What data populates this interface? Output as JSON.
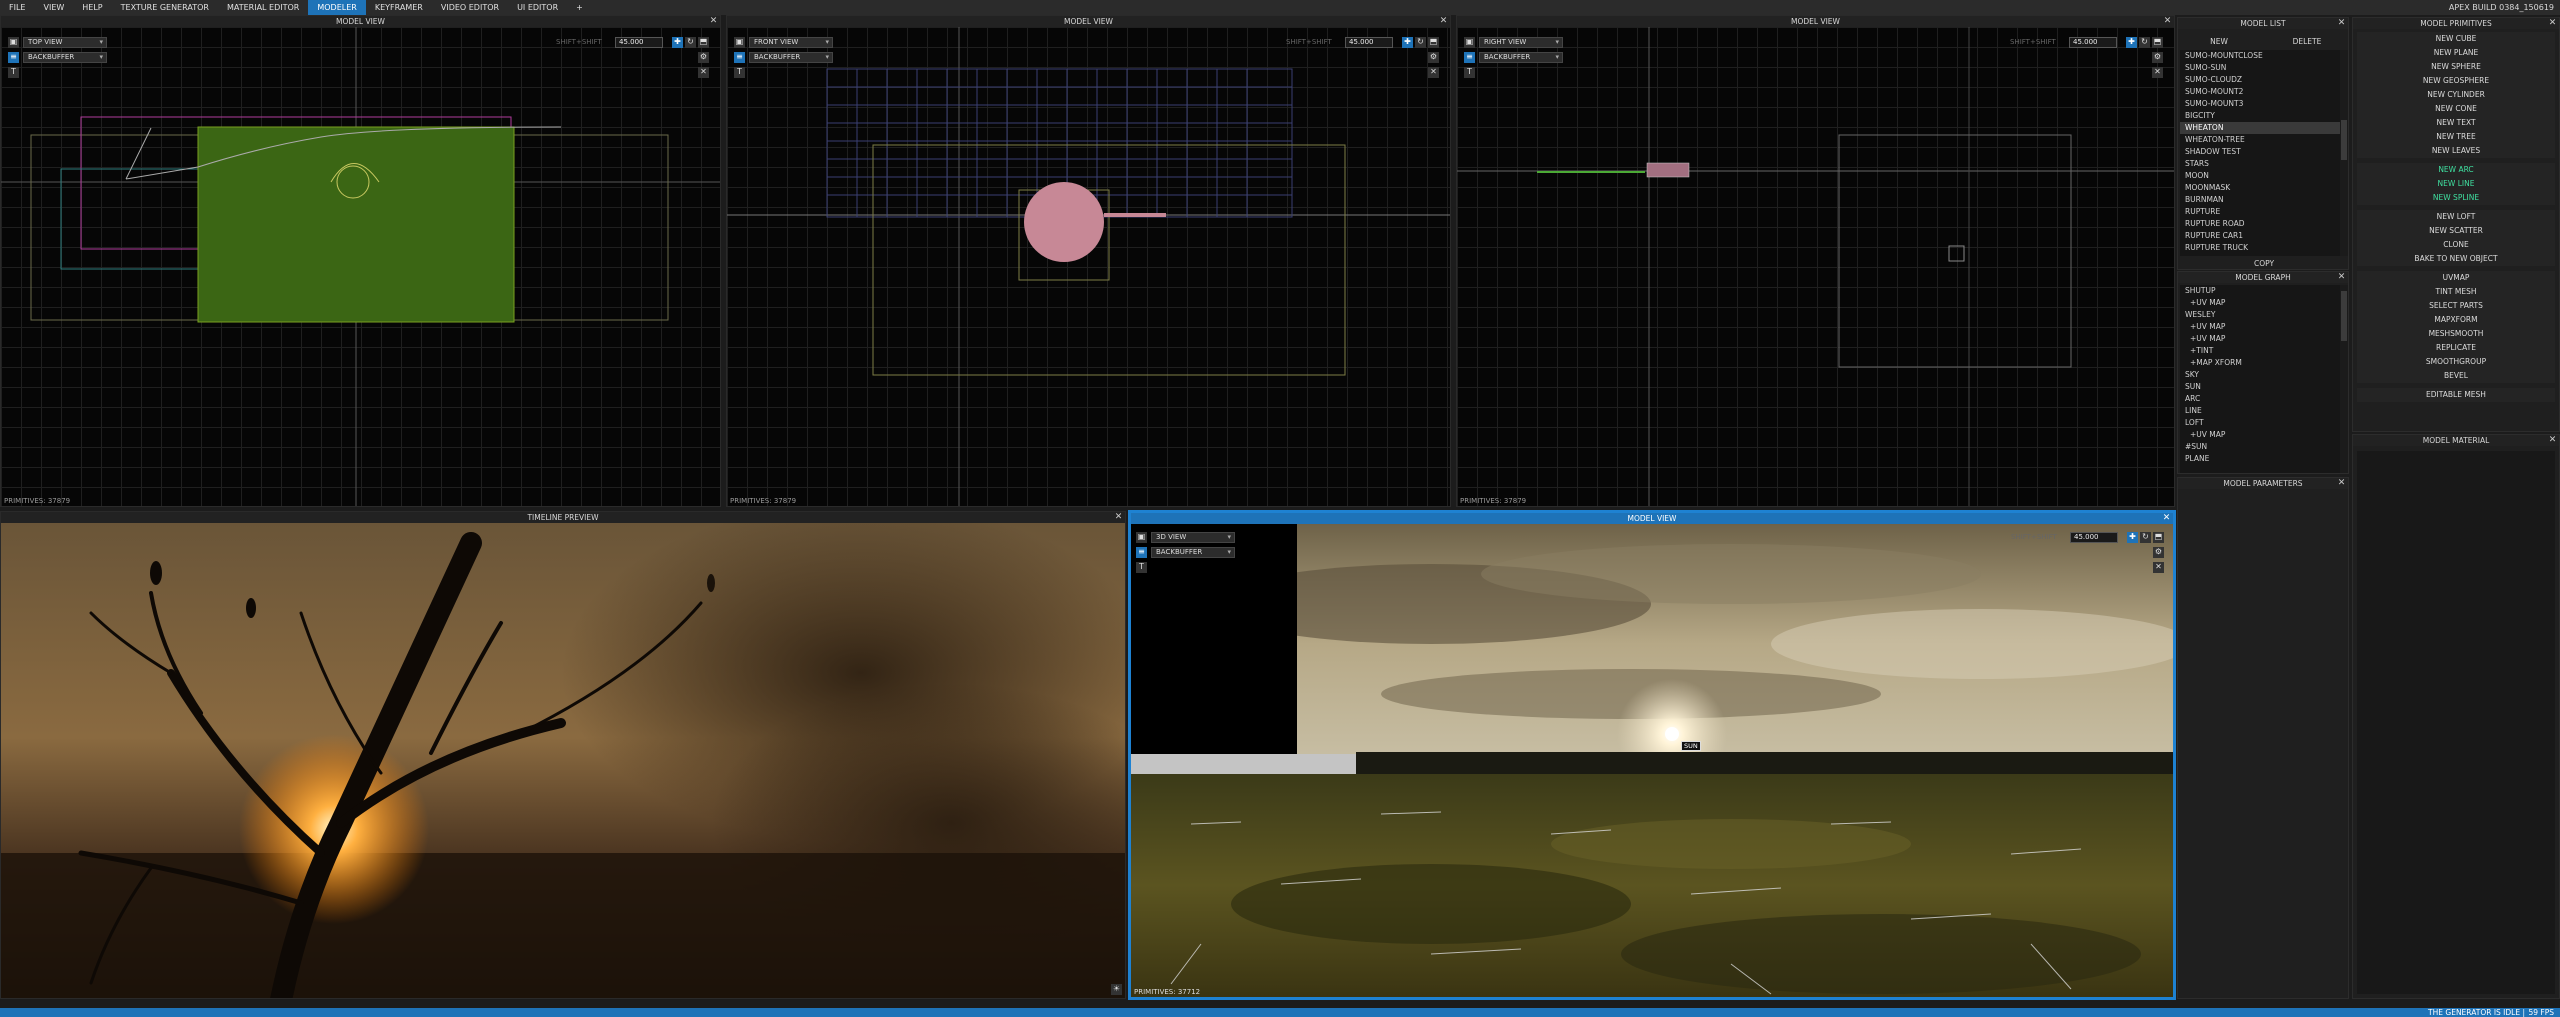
{
  "menu": {
    "items": [
      "FILE",
      "VIEW",
      "HELP",
      "TEXTURE GENERATOR",
      "MATERIAL EDITOR",
      "MODELER",
      "KEYFRAMER",
      "VIDEO EDITOR",
      "UI EDITOR",
      "+"
    ],
    "active_index": 5,
    "build": "APEX BUILD 0384_150619"
  },
  "viewports": {
    "top": {
      "title": "MODEL VIEW",
      "view": "TOP VIEW",
      "buffer": "BACKBUFFER",
      "shift": "SHIFT+SHIFT",
      "fov": "45.000",
      "primitives": "PRIMITIVES: 37879"
    },
    "front": {
      "title": "MODEL VIEW",
      "view": "FRONT VIEW",
      "buffer": "BACKBUFFER",
      "shift": "SHIFT+SHIFT",
      "fov": "45.000",
      "primitives": "PRIMITIVES: 37879"
    },
    "right": {
      "title": "MODEL VIEW",
      "view": "RIGHT VIEW",
      "buffer": "BACKBUFFER",
      "shift": "SHIFT+SHIFT",
      "fov": "45.000",
      "primitives": "PRIMITIVES: 37879"
    },
    "persp": {
      "title": "MODEL VIEW",
      "view": "3D VIEW",
      "buffer": "BACKBUFFER",
      "shift": "SHIFT+SHIFT",
      "fov": "45.000",
      "primitives": "PRIMITIVES: 37712",
      "sun_label": "SUN"
    }
  },
  "timeline": {
    "title": "TIMELINE PREVIEW"
  },
  "model_list": {
    "title": "MODEL LIST",
    "new_label": "NEW",
    "delete_label": "DELETE",
    "copy_label": "COPY",
    "items": [
      "SUMO-MOUNTCLOSE",
      "SUMO-SUN",
      "SUMO-CLOUDZ",
      "SUMO-MOUNT2",
      "SUMO-MOUNT3",
      "BIGCITY",
      "WHEATON",
      "WHEATON-TREE",
      "SHADOW TEST",
      "STARS",
      "MOON",
      "MOONMASK",
      "BURNMAN",
      "RUPTURE",
      "RUPTURE ROAD",
      "RUPTURE CAR1",
      "RUPTURE TRUCK"
    ],
    "selected_index": 6
  },
  "model_graph": {
    "title": "MODEL GRAPH",
    "items": [
      "SHUTUP",
      "+UV MAP",
      "WESLEY",
      "+UV MAP",
      "+UV MAP",
      "+TINT",
      "+MAP XFORM",
      "SKY",
      "SUN",
      "ARC",
      "LINE",
      "LOFT",
      "+UV MAP",
      "#SUN",
      "PLANE"
    ]
  },
  "model_parameters": {
    "title": "MODEL PARAMETERS"
  },
  "primitives": {
    "title": "MODEL PRIMITIVES",
    "group1": [
      "NEW CUBE",
      "NEW PLANE",
      "NEW SPHERE",
      "NEW GEOSPHERE",
      "NEW CYLINDER",
      "NEW CONE",
      "NEW TEXT",
      "NEW TREE",
      "NEW LEAVES"
    ],
    "group2": [
      "NEW ARC",
      "NEW LINE",
      "NEW SPLINE"
    ],
    "group3": [
      "NEW LOFT",
      "NEW SCATTER",
      "CLONE",
      "BAKE TO NEW OBJECT"
    ],
    "group4": [
      "UVMAP",
      "TINT MESH",
      "SELECT PARTS",
      "MAPXFORM",
      "MESHSMOOTH",
      "REPLICATE",
      "SMOOTHGROUP",
      "BEVEL"
    ],
    "group5": [
      "EDITABLE MESH"
    ]
  },
  "model_material": {
    "title": "MODEL MATERIAL"
  },
  "status": {
    "text": "THE GENERATOR IS IDLE |",
    "fps": "59 FPS"
  },
  "colors": {
    "accent": "#1e73b8",
    "green_label": "#3fe0a0",
    "mesh": "#7aa020"
  }
}
